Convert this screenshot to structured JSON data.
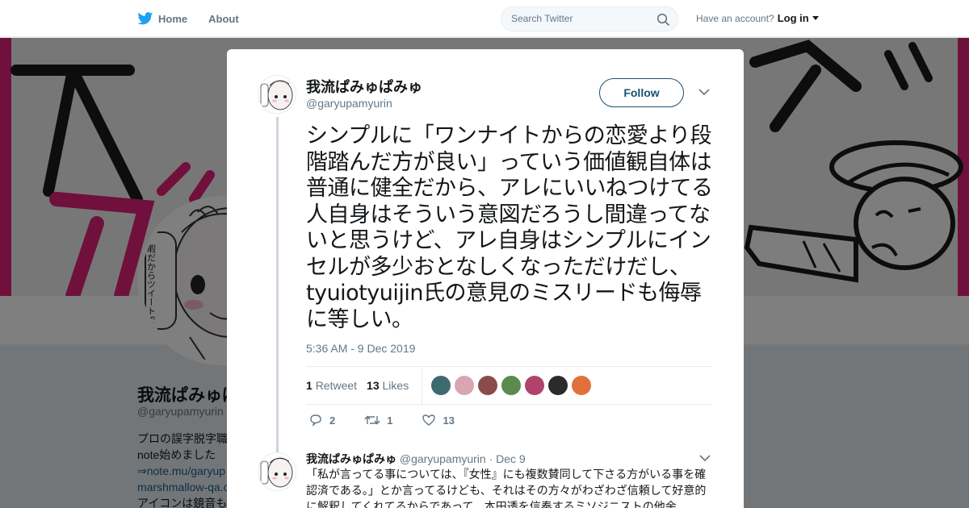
{
  "nav": {
    "home_label": "Home",
    "about_label": "About",
    "search_placeholder": "Search Twitter",
    "have_account": "Have an account?",
    "login_label": "Log in"
  },
  "background_profile": {
    "name": "我流ぱみゅぱみゅ",
    "handle": "@garyupamyurin",
    "bio_lines": [
      "プロの誤字脱字職",
      "note始めました",
      "⇒note.mu/garyup",
      "marshmallow-qa.c",
      "アイコンは鏡音も"
    ],
    "avatar_text": "暇だからツイートでもTLに不穏流すか"
  },
  "tweet": {
    "author_name": "我流ぱみゅぱみゅ",
    "author_handle": "@garyupamyurin",
    "follow_label": "Follow",
    "text": "シンプルに「ワンナイトからの恋愛より段階踏んだ方が良い」っていう価値観自体は普通に健全だから、アレにいいねつけてる人自身はそういう意図だろうし間違ってないと思うけど、アレ自身はシンプルにインセルが多少おとなしくなっただけだし、tyuiotyuijin氏の意見のミスリードも侮辱に等しい。",
    "timestamp": "5:36 AM - 9 Dec 2019",
    "retweet_count": "1",
    "retweet_label": "Retweet",
    "like_count": "13",
    "like_label": "Likes",
    "actions": {
      "reply_count": "2",
      "retweet_count": "1",
      "like_count": "13"
    },
    "liker_colors": [
      "#3d6a6f",
      "#d9a5b3",
      "#8a4b4b",
      "#5c8a4e",
      "#b0436b",
      "#2b2b2b",
      "#e0703c"
    ]
  },
  "reply": {
    "author_name": "我流ぱみゅぱみゅ",
    "meta": "@garyupamyurin · Dec 9",
    "text": "「私が言ってる事については、『女性』にも複数賛同して下さる方がいる事を確認済である。」とか言ってるけども、それはその方々がわざわざ信頼して好意的に解釈してくれてるからであって、本田透を信奉するミソジニストの他余"
  },
  "colors": {
    "accent": "#1da1f2",
    "banner_pink": "#e0217a",
    "follow_border": "#1b4f72"
  }
}
